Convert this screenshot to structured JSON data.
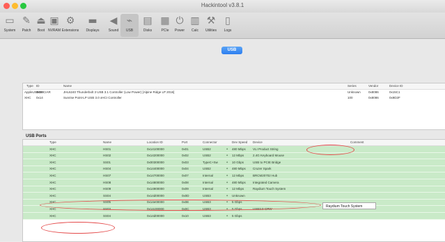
{
  "window": {
    "title": "Hackintool v3.8.1",
    "traffic_colors": [
      "#ff5f57",
      "#febc2e",
      "#28c840"
    ]
  },
  "toolbar": {
    "items": [
      {
        "label": "System",
        "icon": "monitor-icon"
      },
      {
        "label": "Patch",
        "icon": "pencil-icon"
      },
      {
        "label": "Boot",
        "icon": "boot-icon"
      },
      {
        "label": "NVRAM",
        "icon": "chip-icon"
      },
      {
        "label": "Extensions",
        "icon": "gear-icon"
      },
      {
        "label": "Displays",
        "icon": "display-icon"
      },
      {
        "label": "Sound",
        "icon": "speaker-icon"
      },
      {
        "label": "USB",
        "icon": "usb-icon",
        "selected": true
      },
      {
        "label": "Disks",
        "icon": "disk-icon"
      },
      {
        "label": "PCIe",
        "icon": "card-icon"
      },
      {
        "label": "Power",
        "icon": "power-icon"
      },
      {
        "label": "Calc",
        "icon": "calculator-icon"
      },
      {
        "label": "Utilities",
        "icon": "wrench-icon"
      },
      {
        "label": "Logs",
        "icon": "document-icon"
      }
    ]
  },
  "usb_tab_label": "USB",
  "controllers": {
    "headers": [
      "Type",
      "ID",
      "Name",
      "Series",
      "Vendor",
      "Device ID"
    ],
    "rows": [
      [
        "AppleUSBXHCIAR",
        "0x00",
        "JHL6240 Thunderbolt 3 USB 3.1 Controller (Low Power) [Alpine Ridge LP 2016]",
        "Unknown",
        "0x8086",
        "0x15C1"
      ],
      [
        "XHC",
        "0x14",
        "Sunrise Point-LP USB 3.0 xHCI Controller",
        "100",
        "0x8086",
        "0x9D2F"
      ]
    ]
  },
  "usb_ports_title": "USB Ports",
  "ports": {
    "headers": [
      "Type",
      "Name",
      "Location ID",
      "Port",
      "Connector",
      "Dev Speed",
      "Device",
      "Comment"
    ],
    "rows": [
      [
        "XHC",
        "HS01",
        "0x14100000",
        "0x01",
        "USB2",
        "480 Mbps",
        "VLI Product String",
        ""
      ],
      [
        "XHC",
        "HS02",
        "0x14200000",
        "0x02",
        "USB2",
        "12 Mbps",
        "2.4G Keyboard Mouse",
        ""
      ],
      [
        "XHC",
        "SS01",
        "0x00300000",
        "0x03",
        "TypeC+Sw",
        "10 Gbps",
        "USB to PCIE Bridge",
        ""
      ],
      [
        "XHC",
        "HS04",
        "0x14400000",
        "0x04",
        "USB2",
        "480 Mbps",
        "Cruzer Spark",
        ""
      ],
      [
        "XHC",
        "HS07",
        "0x14700000",
        "0x07",
        "Internal",
        "12 Mbps",
        "BRCM20702 Hub",
        ""
      ],
      [
        "XHC",
        "HS08",
        "0x14800000",
        "0x08",
        "Internal",
        "480 Mbps",
        "Integrated Camera",
        ""
      ],
      [
        "XHC",
        "HS09",
        "0x14900000",
        "0x09",
        "Internal",
        "12 Mbps",
        "Raydium Touch System",
        ""
      ],
      [
        "XHC",
        "SS04",
        "0x14d00000",
        "0x0D",
        "USB3",
        "Unknown",
        "",
        ""
      ],
      [
        "XHC",
        "SS05",
        "0x14e00000",
        "0x0E",
        "USB3",
        "5 Gbps",
        "",
        ""
      ],
      [
        "XHC",
        "SS03",
        "0x14c00000",
        "0x0C",
        "USB3",
        "5 Gbps",
        "USB3.0-CRW",
        ""
      ],
      [
        "XHC",
        "SS04",
        "0x14d00000",
        "0x10",
        "USB3",
        "5 Gbps",
        "",
        ""
      ]
    ]
  },
  "tooltip": "Raydium Touch System",
  "highlight_color": "#e44949"
}
